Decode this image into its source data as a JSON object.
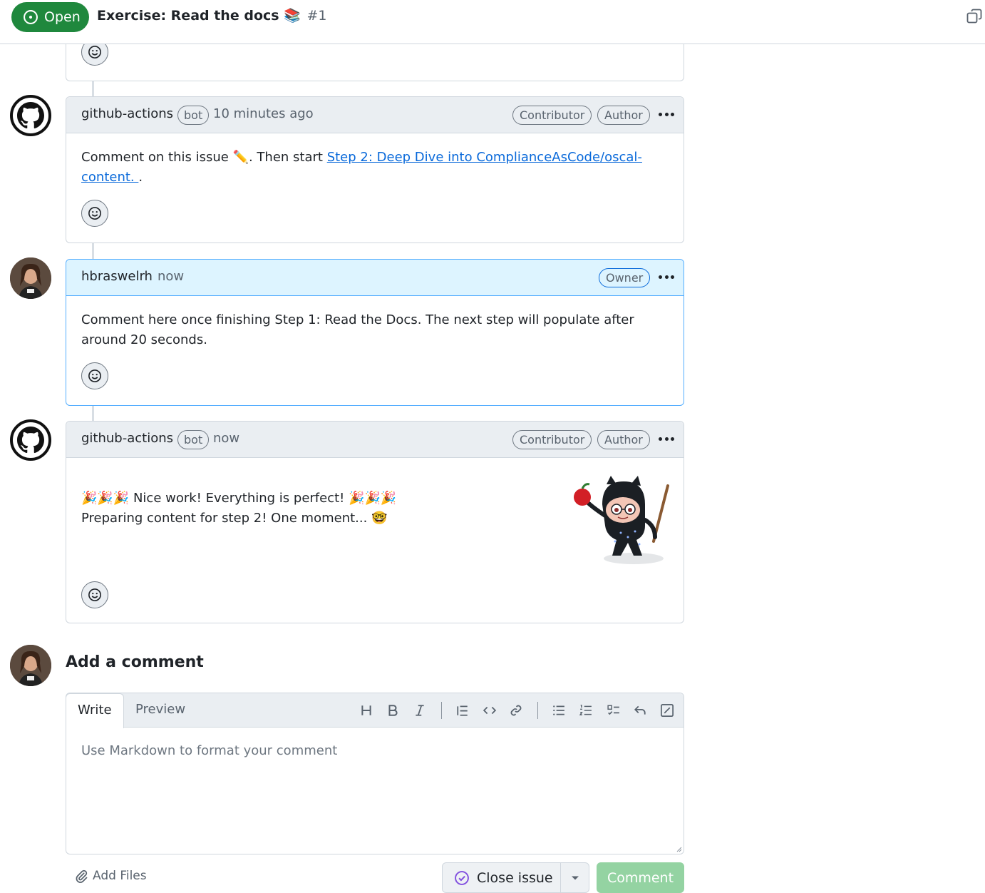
{
  "header": {
    "state": "Open",
    "title": "Exercise: Read the docs 📚",
    "number": "#1"
  },
  "comments": [
    {
      "author": "github-actions",
      "bot_label": "bot",
      "time": "10 minutes ago",
      "roles": [
        "Contributor",
        "Author"
      ],
      "body_prefix": "Comment on this issue ✏️. Then start ",
      "link_text": "Step 2: Deep Dive into ComplianceAsCode/oscal-content. ",
      "body_suffix": "."
    },
    {
      "author": "hbraswelrh",
      "time": "now",
      "roles": [
        "Owner"
      ],
      "body": "Comment here once finishing Step 1: Read the Docs. The next step will populate after around 20 seconds."
    },
    {
      "author": "github-actions",
      "bot_label": "bot",
      "time": "now",
      "roles": [
        "Contributor",
        "Author"
      ],
      "line1": "🎉🎉🎉 Nice work! Everything is perfect! 🎉🎉🎉",
      "line2": "Preparing content for step 2! One moment... 🤓"
    }
  ],
  "composer": {
    "heading": "Add a comment",
    "tabs": [
      "Write",
      "Preview"
    ],
    "placeholder": "Use Markdown to format your comment",
    "add_files": "Add Files",
    "close_issue": "Close issue",
    "comment": "Comment"
  },
  "colors": {
    "open_green": "#1f883d",
    "link_blue": "#0969da",
    "owner_header": "#ddf4ff",
    "comment_disabled": "#94d3a2"
  },
  "icons": [
    "issue-opened-icon",
    "copy-icon",
    "github-logo-icon",
    "smiley-icon",
    "kebab-horizontal-icon",
    "heading-icon",
    "bold-icon",
    "italic-icon",
    "quote-icon",
    "code-icon",
    "link-icon",
    "unordered-list-icon",
    "ordered-list-icon",
    "tasklist-icon",
    "reply-icon",
    "slash-command-icon",
    "paperclip-icon",
    "issue-closed-icon",
    "triangle-down-icon"
  ]
}
